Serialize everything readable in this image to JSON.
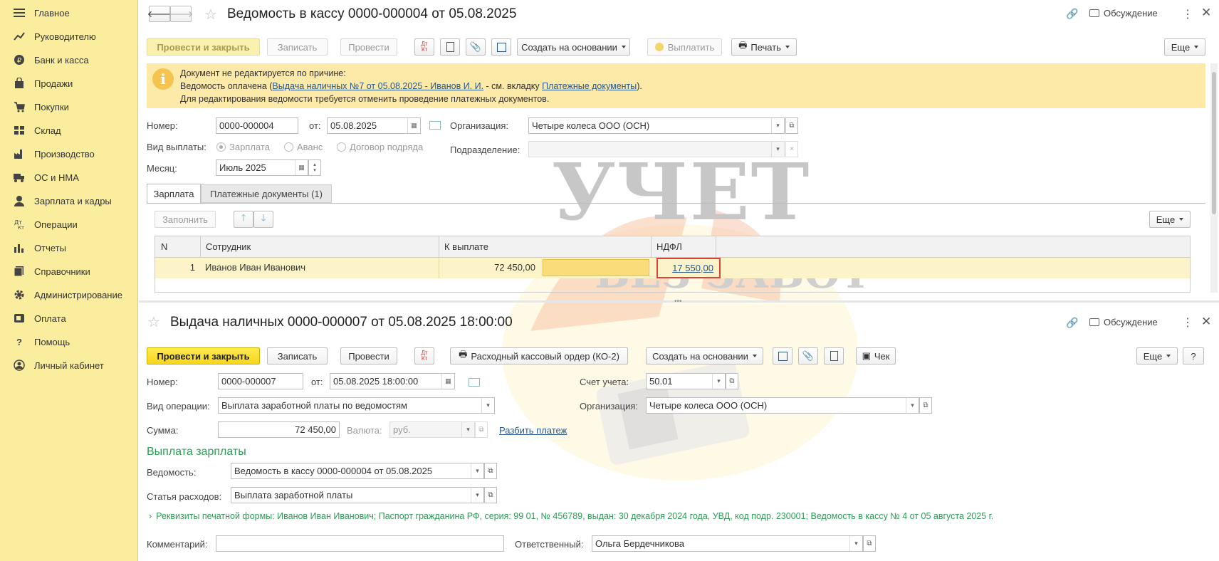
{
  "sidebar": {
    "items": [
      {
        "label": "Главное",
        "icon": "menu-icon"
      },
      {
        "label": "Руководителю",
        "icon": "trend-icon"
      },
      {
        "label": "Банк и касса",
        "icon": "ruble-coin-icon"
      },
      {
        "label": "Продажи",
        "icon": "bag-icon"
      },
      {
        "label": "Покупки",
        "icon": "cart-icon"
      },
      {
        "label": "Склад",
        "icon": "warehouse-icon"
      },
      {
        "label": "Производство",
        "icon": "factory-icon"
      },
      {
        "label": "ОС и НМА",
        "icon": "truck-icon"
      },
      {
        "label": "Зарплата и кадры",
        "icon": "person-icon"
      },
      {
        "label": "Операции",
        "icon": "dt-kt-icon"
      },
      {
        "label": "Отчеты",
        "icon": "bar-chart-icon"
      },
      {
        "label": "Справочники",
        "icon": "books-icon"
      },
      {
        "label": "Администрирование",
        "icon": "gear-icon"
      },
      {
        "label": "Оплата",
        "icon": "payment-icon"
      },
      {
        "label": "Помощь",
        "icon": "question-icon"
      },
      {
        "label": "Личный кабинет",
        "icon": "account-icon"
      }
    ]
  },
  "doc1": {
    "title": "Ведомость в кассу 0000-000004 от 05.08.2025",
    "discuss": "Обсуждение",
    "toolbar": {
      "post_close": "Провести и закрыть",
      "save": "Записать",
      "post": "Провести",
      "create_based": "Создать на основании",
      "pay": "Выплатить",
      "print": "Печать",
      "more": "Еще"
    },
    "notice": {
      "line1": "Документ не редактируется по причине:",
      "line2_a": "Ведомость оплачена (",
      "line2_link": "Выдача наличных №7 от 05.08.2025 - Иванов И. И.",
      "line2_b": " - см. вкладку ",
      "line2_link2": "Платежные документы",
      "line2_c": ").",
      "line3": "Для редактирования ведомости требуется отменить проведение платежных документов."
    },
    "number_label": "Номер:",
    "number": "0000-000004",
    "date_label": "от:",
    "date": "05.08.2025",
    "org_label": "Организация:",
    "org": "Четыре колеса ООО (ОСН)",
    "pay_type_label": "Вид выплаты:",
    "pay_types": [
      "Зарплата",
      "Аванс",
      "Договор подряда"
    ],
    "dept_label": "Подразделение:",
    "dept": "",
    "month_label": "Месяц:",
    "month": "Июль 2025",
    "tabs": [
      "Зарплата",
      "Платежные документы (1)"
    ],
    "fill": "Заполнить",
    "more": "Еще",
    "table": {
      "headers": [
        "N",
        "Сотрудник",
        "К выплате",
        "НДФЛ"
      ],
      "rows": [
        {
          "n": "1",
          "employee": "Иванов Иван Иванович",
          "amount": "72 450,00",
          "ndfl": "17 550,00"
        }
      ]
    }
  },
  "doc2": {
    "title": "Выдача наличных 0000-000007 от 05.08.2025 18:00:00",
    "discuss": "Обсуждение",
    "toolbar": {
      "post_close": "Провести и закрыть",
      "save": "Записать",
      "post": "Провести",
      "cash_order": "Расходный кассовый ордер (КО-2)",
      "create_based": "Создать на основании",
      "check": "Чек",
      "more": "Еще",
      "help": "?"
    },
    "number_label": "Номер:",
    "number": "0000-000007",
    "date_label": "от:",
    "date": "05.08.2025 18:00:00",
    "account_label": "Счет учета:",
    "account": "50.01",
    "op_label": "Вид операции:",
    "op": "Выплата заработной платы по ведомостям",
    "org_label": "Организация:",
    "org": "Четыре колеса ООО (ОСН)",
    "sum_label": "Сумма:",
    "sum": "72 450,00",
    "currency_label": "Валюта:",
    "currency": "руб.",
    "split": "Разбить платеж",
    "section": "Выплата зарплаты",
    "statement_label": "Ведомость:",
    "statement": "Ведомость в кассу 0000-000004 от 05.08.2025",
    "expense_label": "Статья расходов:",
    "expense": "Выплата заработной платы",
    "requisites": "Реквизиты печатной формы: Иванов Иван Иванович; Паспорт гражданина РФ, серия: 99 01, № 456789, выдан: 30 декабря 2024 года, УВД, код подр. 230001; Ведомость в кассу № 4 от 05 августа 2025 г.",
    "comment_label": "Комментарий:",
    "comment": "",
    "resp_label": "Ответственный:",
    "resp": "Ольга Бердечникова"
  },
  "watermark": {
    "line1": "УЧЕТ",
    "line2": "БЕЗ ЗАБОТ"
  },
  "colors": {
    "sidebar": "#fbed9e",
    "notice": "#fde9a8",
    "accent_yellow": "#f7d61c",
    "link": "#2a5885",
    "highlight_border": "#d9413a",
    "green": "#2e9a55"
  }
}
